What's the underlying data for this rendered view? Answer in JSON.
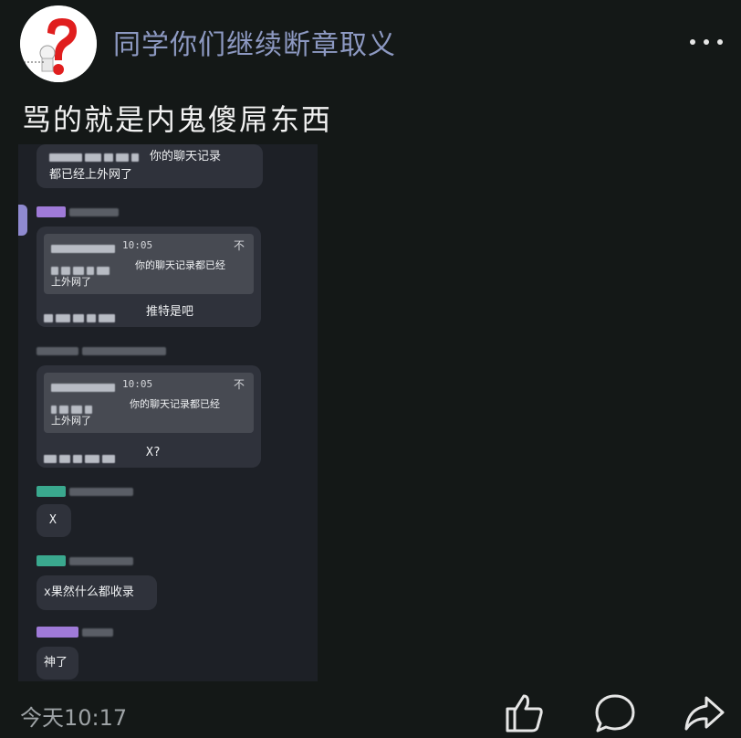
{
  "header": {
    "username": "同学你们继续断章取义",
    "more_label": "更多"
  },
  "post": {
    "text": "骂的就是内鬼傻屌东西",
    "time": "今天10:17"
  },
  "screenshot": {
    "messages": [
      {
        "kind": "text",
        "text": "你的聊天记录\n都已经上外网了"
      },
      {
        "kind": "quote",
        "quote_time": "10:05",
        "quote_pin": "不",
        "quote_text": "你的聊天记录都已经\n上外网了",
        "reply": "推特是吧"
      },
      {
        "kind": "quote",
        "quote_time": "10:05",
        "quote_pin": "不",
        "quote_text": "你的聊天记录都已经\n上外网了",
        "reply": "X?"
      },
      {
        "kind": "text",
        "text": "X"
      },
      {
        "kind": "text",
        "text": "x果然什么都收录"
      },
      {
        "kind": "text",
        "text": "神了"
      }
    ]
  },
  "colors": {
    "background": "#141817",
    "username": "#8d99c2",
    "bubble": "#2f323b",
    "tag_purple": "#9f7ad8",
    "tag_teal": "#3aa88e"
  },
  "icons": [
    "more-icon",
    "like-icon",
    "comment-icon",
    "share-icon",
    "question-mark-avatar"
  ]
}
